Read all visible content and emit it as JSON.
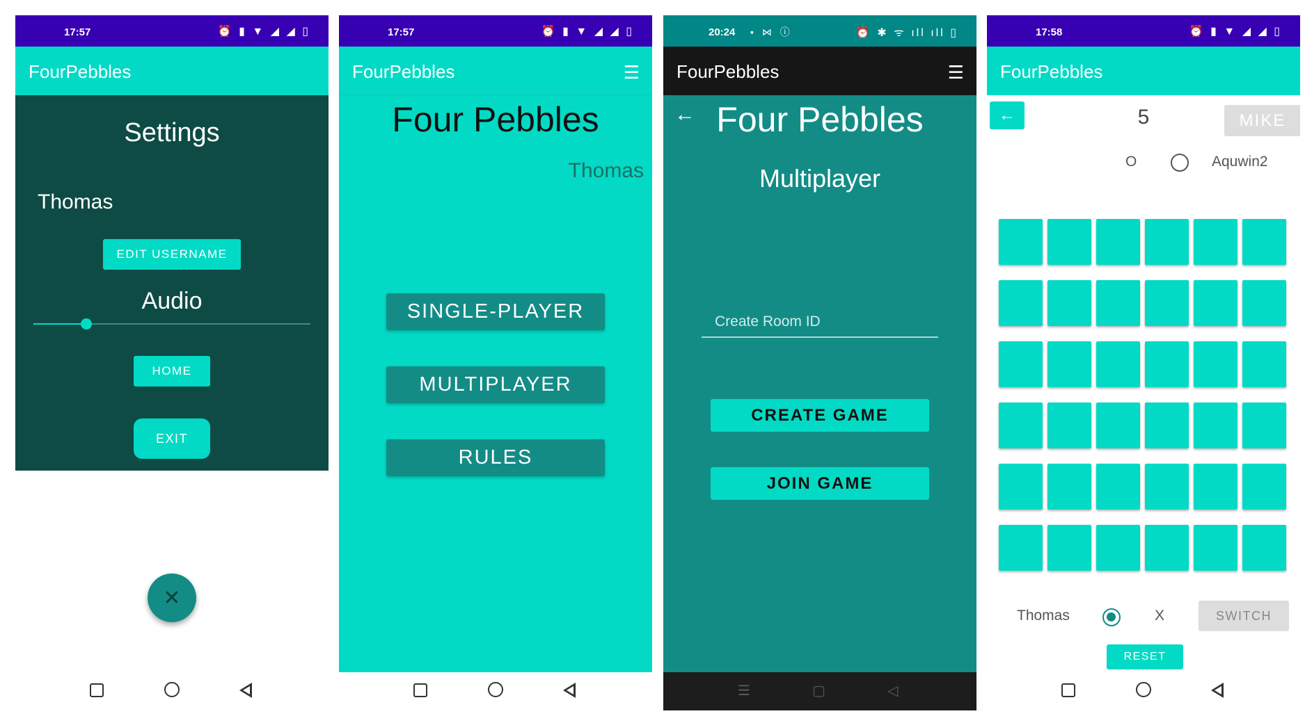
{
  "app_title": "FourPebbles",
  "colors": {
    "primary": "#03dac5",
    "primary_variant": "#3700b3",
    "dark_teal": "#0e4b45",
    "teal": "#138c86"
  },
  "settings_screen": {
    "status_time": "17:57",
    "status_icons": "⏰ ▮ ▼ ◢ ◢ ▯",
    "heading": "Settings",
    "username": "Thomas",
    "edit_username_button": "EDIT USERNAME",
    "audio_heading": "Audio",
    "audio_volume_fraction": 0.19,
    "home_button": "HOME",
    "exit_button": "EXIT",
    "fab_icon": "close-icon",
    "fab_glyph": "✕"
  },
  "home_screen": {
    "status_time": "17:57",
    "status_icons": "⏰ ▮ ▼ ◢ ◢ ▯",
    "heading": "Four Pebbles",
    "player_name": "Thomas",
    "menu_glyph": "☰",
    "buttons": [
      "SINGLE-PLAYER",
      "MULTIPLAYER",
      "RULES"
    ]
  },
  "multiplayer_screen": {
    "status_time": "20:24",
    "status_extra": "▪ ⋈ ⓘ",
    "status_icons": "⏰ ✱ ᯤ ıll ıll ▯",
    "heading": "Four Pebbles",
    "subheading": "Multiplayer",
    "back_glyph": "←",
    "menu_glyph": "☰",
    "room_input_placeholder": "Create Room ID",
    "room_input_value": "",
    "create_button": "CREATE GAME",
    "join_button": "JOIN GAME",
    "nav_glyphs": [
      "☰",
      "▢",
      "◁"
    ]
  },
  "game_screen": {
    "status_time": "17:58",
    "status_icons": "⏰ ▮ ▼ ◢ ◢ ▯",
    "back_glyph": "←",
    "score": "5",
    "opponent_button": "MIKE",
    "opponent_mark": "O",
    "opponent_name": "Aquwin2",
    "opponent_selected": false,
    "grid_rows": 6,
    "grid_cols": 6,
    "player_name": "Thomas",
    "player_selected": true,
    "player_mark": "X",
    "switch_button": "SWITCH",
    "reset_button": "RESET"
  }
}
